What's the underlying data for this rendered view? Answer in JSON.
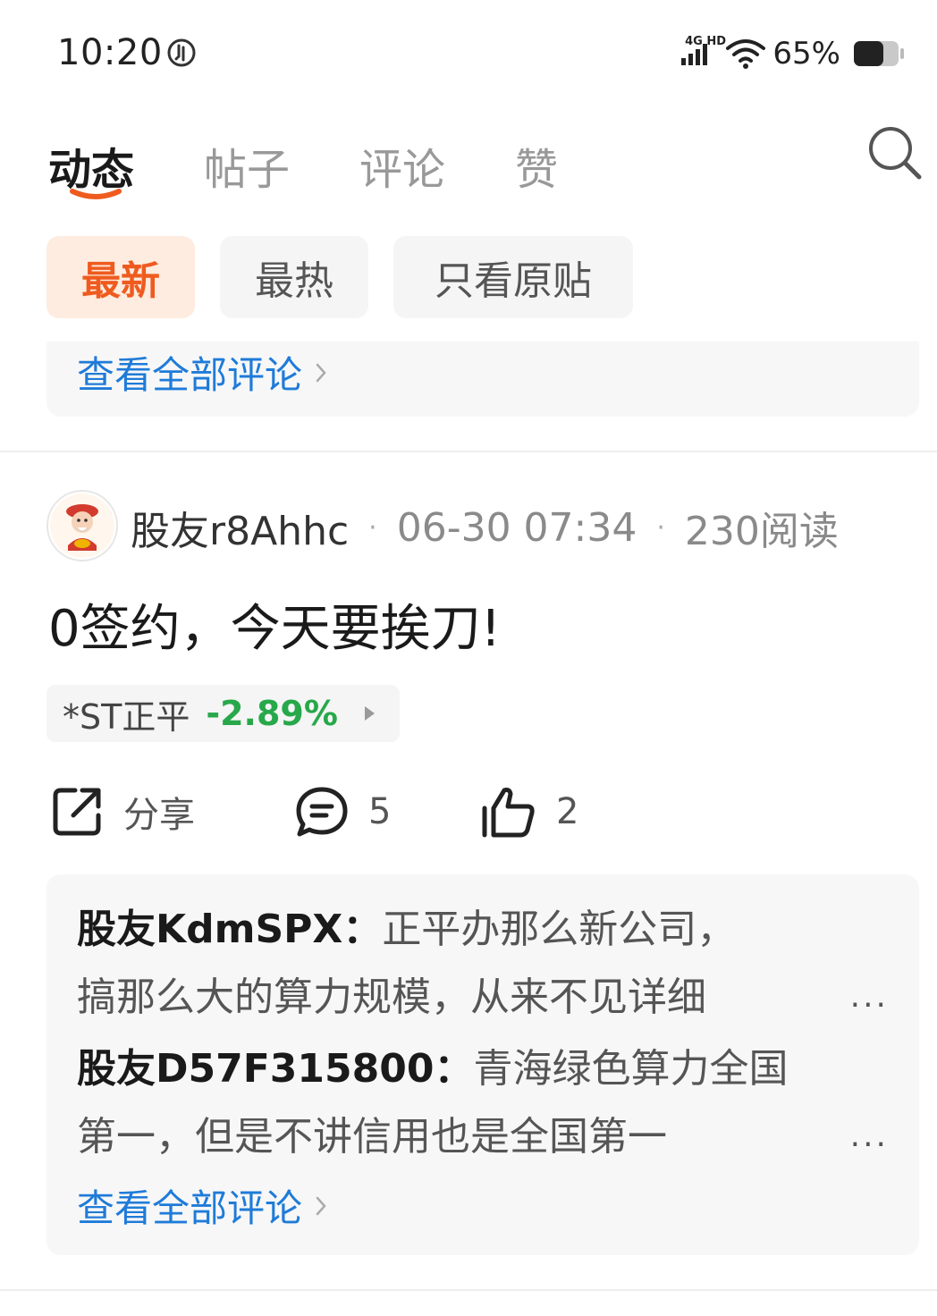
{
  "status_bar": {
    "time": "10:20",
    "network_label": "4G HD",
    "battery_percent": "65%",
    "battery_level": 0.65
  },
  "tabs": [
    {
      "label": "动态",
      "active": true
    },
    {
      "label": "帖子",
      "active": false
    },
    {
      "label": "评论",
      "active": false
    },
    {
      "label": "赞",
      "active": false
    }
  ],
  "filters": [
    {
      "label": "最新",
      "active": true
    },
    {
      "label": "最热",
      "active": false
    },
    {
      "label": "只看原贴",
      "active": false
    }
  ],
  "previous_card": {
    "view_all_label": "查看全部评论"
  },
  "post": {
    "author": "股友r8Ahhc",
    "date": "06-30 07:34",
    "reads": "230阅读",
    "text": "0签约，今天要挨刀!",
    "stock": {
      "name": "*ST正平",
      "change": "-2.89%"
    },
    "actions": {
      "share_label": "分享",
      "comment_count": "5",
      "like_count": "2"
    },
    "comments": [
      {
        "user": "股友KdmSPX",
        "separator": "：",
        "line1": "正平办那么新公司，",
        "line2": "搞那么大的算力规模，从来不见详细"
      },
      {
        "user": "股友D57F315800",
        "separator": "：",
        "line1": "青海绿色算力全国",
        "line2": "第一，但是不讲信用也是全国第一"
      }
    ],
    "more_label": "...",
    "view_all_label": "查看全部评论"
  },
  "colors": {
    "accent": "#ef5b1f",
    "link": "#1f7bd8",
    "down": "#27a84a"
  }
}
